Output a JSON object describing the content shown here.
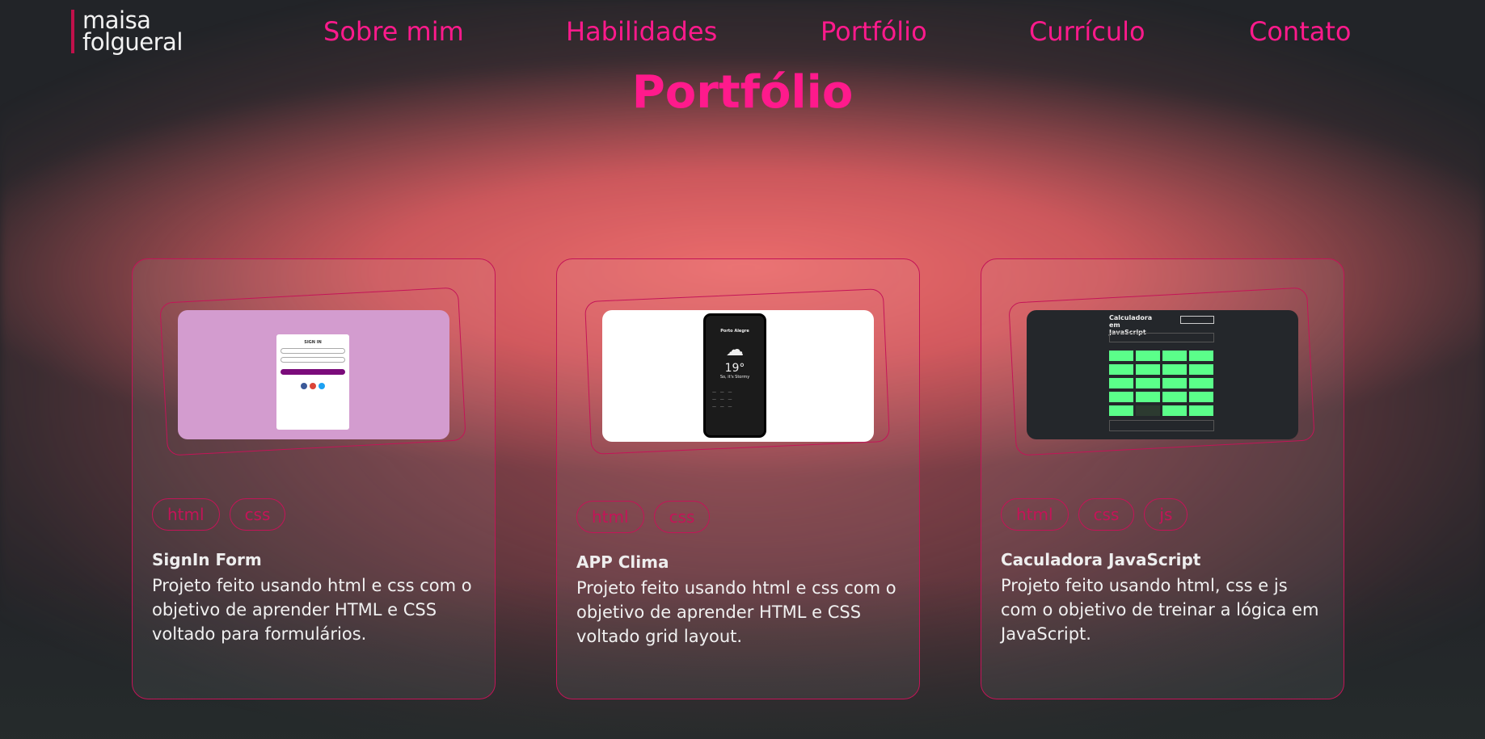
{
  "logo": {
    "line1": "maisa",
    "line2": "folgueral"
  },
  "nav": [
    "Sobre mim",
    "Habilidades",
    "Portfólio",
    "Currículo",
    "Contato"
  ],
  "page_title": "Portfólio",
  "projects": [
    {
      "tags": [
        "html",
        "css"
      ],
      "title": "SignIn Form",
      "description": "Projeto feito usando html e css com o objetivo de aprender HTML e CSS voltado para formulários.",
      "preview": {
        "heading": "SIGN IN"
      }
    },
    {
      "tags": [
        "html",
        "css"
      ],
      "title": "APP Clima",
      "description": "Projeto feito usando html e css com o objetivo de aprender HTML e CSS voltado grid layout.",
      "preview": {
        "city": "Porto Alegre",
        "temp": "19°",
        "status": "So, it's Stormy"
      }
    },
    {
      "tags": [
        "html",
        "css",
        "js"
      ],
      "title": "Caculadora JavaScript",
      "description": "Projeto feito usando html, css e js com o objetivo de treinar a lógica em JavaScript.",
      "preview": {
        "heading": "Calculadora em JavaScript"
      }
    }
  ],
  "colors": {
    "accent": "#ff1a8c",
    "border": "#c41458",
    "background": "#222428"
  }
}
